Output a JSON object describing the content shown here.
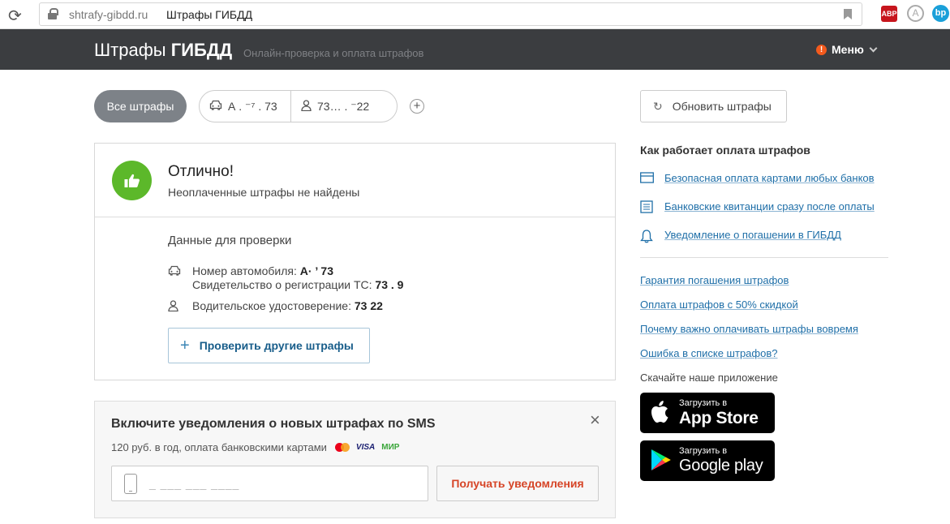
{
  "browser": {
    "url_domain": "shtrafy-gibdd.ru",
    "tab_title": "Штрафы ГИБДД",
    "ext_abp": "ABP"
  },
  "header": {
    "brand_plain": "Штрафы ",
    "brand_bold": "ГИБДД",
    "tagline": "Онлайн-проверка и оплата штрафов",
    "menu_label": "Меню",
    "menu_alert": "!"
  },
  "filters": {
    "all_label": "Все штрафы",
    "car_label": "А  . ⁻⁷ . 73",
    "license_label": "73… .  ⁻22",
    "add_label": "+"
  },
  "refresh_label": "Обновить штрафы",
  "result": {
    "title": "Отлично!",
    "subtitle": "Неоплаченные штрафы не найдены",
    "data_title": "Данные для проверки",
    "car_number_label": "Номер автомобиля: ",
    "car_number_value": "А· ’  73",
    "sts_label": "Свидетельство о регистрации ТС: ",
    "sts_value": "73 .           9",
    "license_label": "Водительское удостоверение: ",
    "license_value": "73            22",
    "check_other": "Проверить другие штрафы"
  },
  "sms": {
    "title": "Включите уведомления о новых штрафах по SMS",
    "subtitle": "120 руб. в год, оплата банковскими картами",
    "visa": "VISA",
    "mir": "МИР",
    "phone_placeholder": "_ ___ ___ ____",
    "button": "Получать уведомления",
    "close": "×"
  },
  "sidebar": {
    "title": "Как работает оплата штрафов",
    "features": [
      "Безопасная оплата картами любых банков",
      "Банковские квитанции сразу после оплаты",
      "Уведомление о погашении в ГИБДД"
    ],
    "links": [
      "Гарантия погашения штрафов",
      "Оплата штрафов с 50% скидкой",
      "Почему важно оплачивать штрафы вовремя",
      "Ошибка в списке штрафов?"
    ],
    "app_label": "Скачайте наше приложение",
    "appstore_small": "Загрузить в",
    "appstore_big": "App Store",
    "gplay_small": "Загрузить в",
    "gplay_big": "Google play"
  }
}
